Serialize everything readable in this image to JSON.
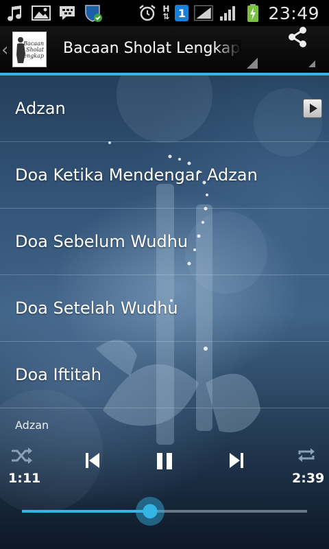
{
  "status_bar": {
    "time": "23:49",
    "network_label": "H",
    "sim_slot": "1",
    "icons": [
      "music-icon",
      "gallery-icon",
      "bbm-icon",
      "shield-icon",
      "alarm-icon",
      "signal-icon",
      "battery-icon"
    ]
  },
  "action_bar": {
    "title": "Bacaan Sholat Lengkap",
    "logo_text": [
      "Bacaan",
      "Sholat",
      "lengkap"
    ],
    "accent_color": "#33b5e5"
  },
  "list": {
    "items": [
      {
        "label": "Adzan",
        "has_play": true
      },
      {
        "label": "Doa Ketika Mendengar Adzan",
        "has_play": false
      },
      {
        "label": "Doa Sebelum Wudhu",
        "has_play": false
      },
      {
        "label": "Doa Setelah Wudhu",
        "has_play": false
      },
      {
        "label": "Doa Iftitah",
        "has_play": false
      }
    ]
  },
  "player": {
    "now_playing": "Adzan",
    "elapsed": "1:11",
    "duration": "2:39",
    "progress_fraction": 0.45,
    "state": "playing"
  }
}
